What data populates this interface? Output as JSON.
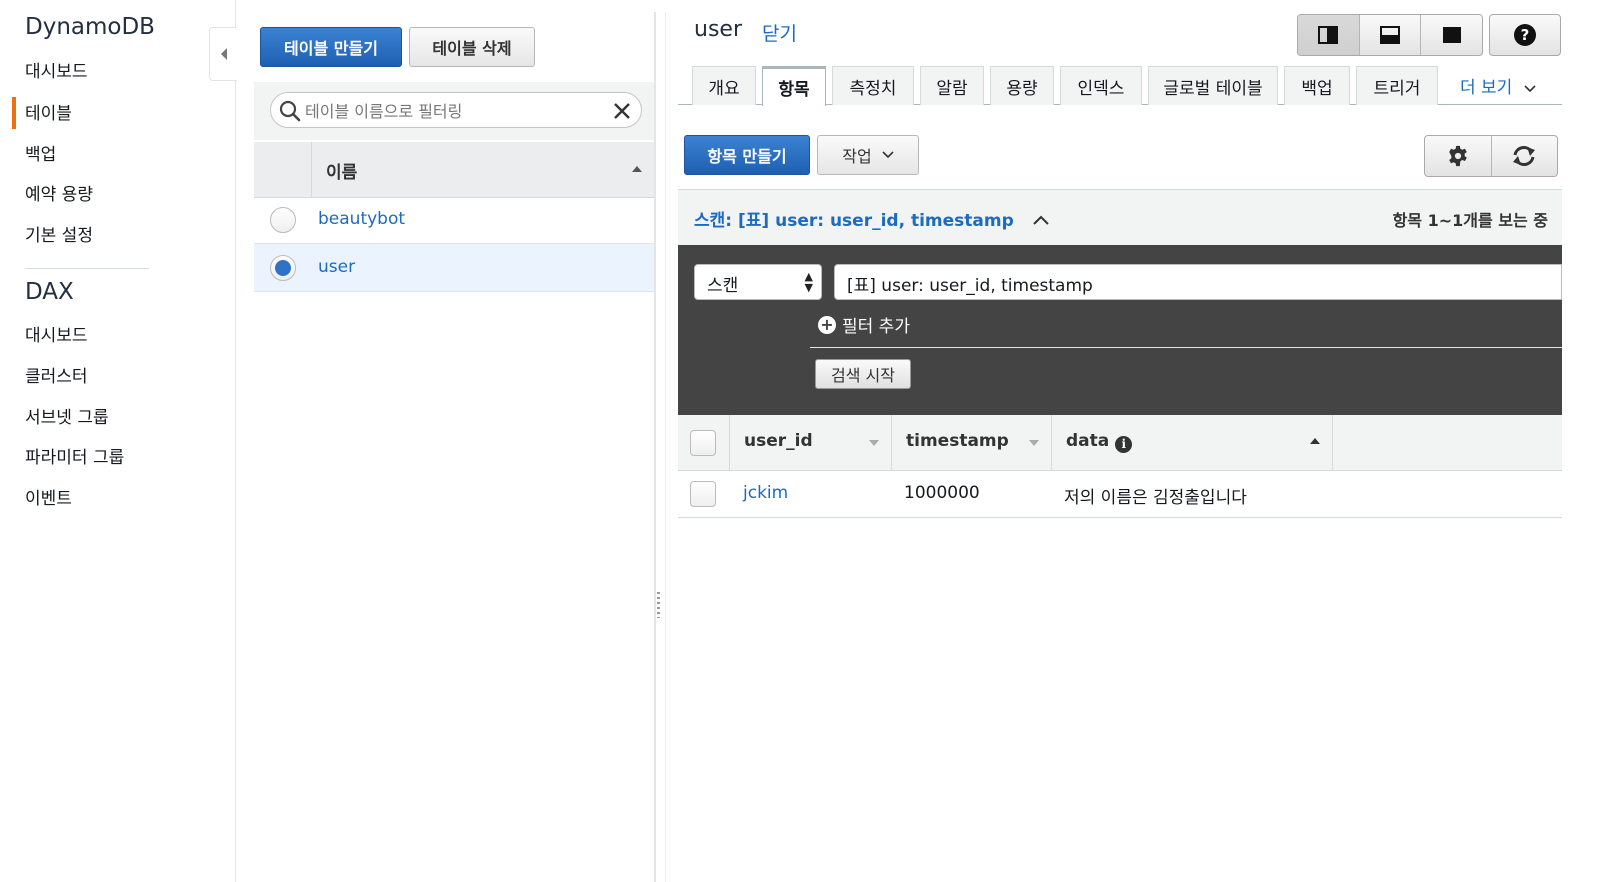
{
  "nav": {
    "section1_title": "DynamoDB",
    "section1_items": [
      "대시보드",
      "테이블",
      "백업",
      "예약 용량",
      "기본 설정"
    ],
    "active_item": "테이블",
    "section2_title": "DAX",
    "section2_items": [
      "대시보드",
      "클러스터",
      "서브넷 그룹",
      "파라미터 그룹",
      "이벤트"
    ]
  },
  "tables_pane": {
    "create_button": "테이블 만들기",
    "delete_button": "테이블 삭제",
    "filter_placeholder": "테이블 이름으로 필터링",
    "column_header": "이름",
    "rows": [
      {
        "name": "beautybot",
        "selected": false
      },
      {
        "name": "user",
        "selected": true
      }
    ]
  },
  "detail": {
    "table_name": "user",
    "close_link": "닫기",
    "tabs": [
      "개요",
      "항목",
      "측정치",
      "알람",
      "용량",
      "인덱스",
      "글로벌 테이블",
      "백업",
      "트리거"
    ],
    "active_tab": "항목",
    "more_tabs": "더 보기",
    "create_item_button": "항목 만들기",
    "actions_button": "작업",
    "scan_header": "스캔: [표] user: user_id, timestamp",
    "item_count": "항목 1~1개를 보는 중",
    "scan_mode": "스캔",
    "scan_target": "[표] user: user_id, timestamp",
    "add_filter": "필터 추가",
    "start_search": "검색 시작",
    "columns": [
      "user_id",
      "timestamp",
      "data"
    ],
    "items": [
      {
        "user_id": "jckim",
        "timestamp": "1000000",
        "data": "저의 이름은 김정출입니다"
      }
    ]
  },
  "colors": {
    "accent_orange": "#ec7211",
    "primary_blue": "#1f5fb1",
    "link_blue": "#1d6bc0",
    "scan_panel_bg": "#444444"
  }
}
